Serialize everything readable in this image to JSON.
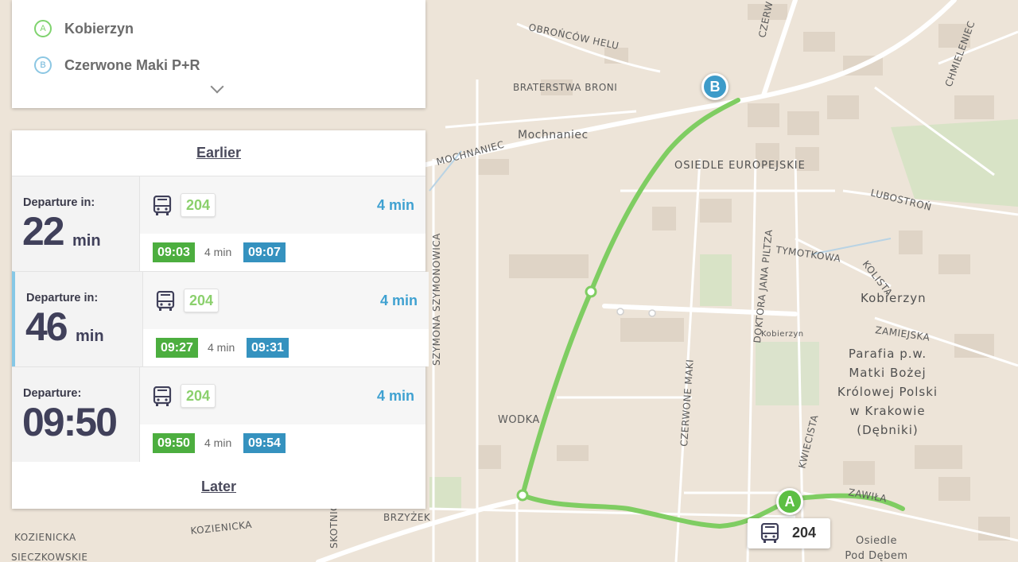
{
  "stops": {
    "a": {
      "badge": "A",
      "name": "Kobierzyn"
    },
    "b": {
      "badge": "B",
      "name": "Czerwone Maki P+R"
    }
  },
  "nav": {
    "earlier": "Earlier",
    "later": "Later"
  },
  "departures": [
    {
      "label": "Departure in:",
      "value": "22",
      "unit": "min",
      "line": "204",
      "duration": "4 min",
      "depart_time": "09:03",
      "ride": "4 min",
      "arrive_time": "09:07",
      "active": false
    },
    {
      "label": "Departure in:",
      "value": "46",
      "unit": "min",
      "line": "204",
      "duration": "4 min",
      "depart_time": "09:27",
      "ride": "4 min",
      "arrive_time": "09:31",
      "active": true
    },
    {
      "label": "Departure:",
      "value": "09:50",
      "unit": "",
      "line": "204",
      "duration": "4 min",
      "depart_time": "09:50",
      "ride": "4 min",
      "arrive_time": "09:54",
      "active": false
    }
  ],
  "map": {
    "marker_a": "A",
    "marker_b": "B",
    "bus_line": "204",
    "labels": {
      "obroncow": "OBROŃCÓW HELU",
      "braterstwa": "BRATERSTWA BRONI",
      "mochnaniec": "Mochnaniec",
      "mochnaniec_st": "MOCHNANIEC",
      "osiedle_eur": "OSIEDLE EUROPEJSKIE",
      "lubostron": "LUBOSTROŃ",
      "tymotkowa": "TYMOTKOWA",
      "kolista": "KOLISTA",
      "kobierzyn": "Kobierzyn",
      "kobierzyn_small": "Kobierzyn",
      "zamiejska": "ZAMIEJSKA",
      "parafia": [
        "Parafia p.w.",
        "Matki Bożej",
        "Królowej Polski",
        "w Krakowie",
        "(Dębniki)"
      ],
      "szymonowica": "SZYMONA SZYMONOWICA",
      "piltza": "DOKTORA JANA PILTZA",
      "czerwone_maki": "CZERWONE MAKI",
      "czerwone_top": "CZERW",
      "kwiecista": "KWIECISTA",
      "zawila": "ZAWIŁA",
      "osiedle_pod": [
        "Osiedle",
        "Pod Dębem"
      ],
      "wodka": "WODKA",
      "brzyzek": "BRZYŻEK",
      "kozienicka": "KOZIENICKA",
      "kozienicka2": "KOZIENICKA",
      "sieczkowskie": "SIECZKOWSKIE",
      "chmieleniec": "CHMIELENIEC",
      "skotnicka": "SKOTNICKA"
    }
  },
  "colors": {
    "route": "#7fcd62",
    "accent_blue": "#3fa1d1",
    "green_badge": "#4cae3f",
    "blue_badge": "#3592bf"
  }
}
